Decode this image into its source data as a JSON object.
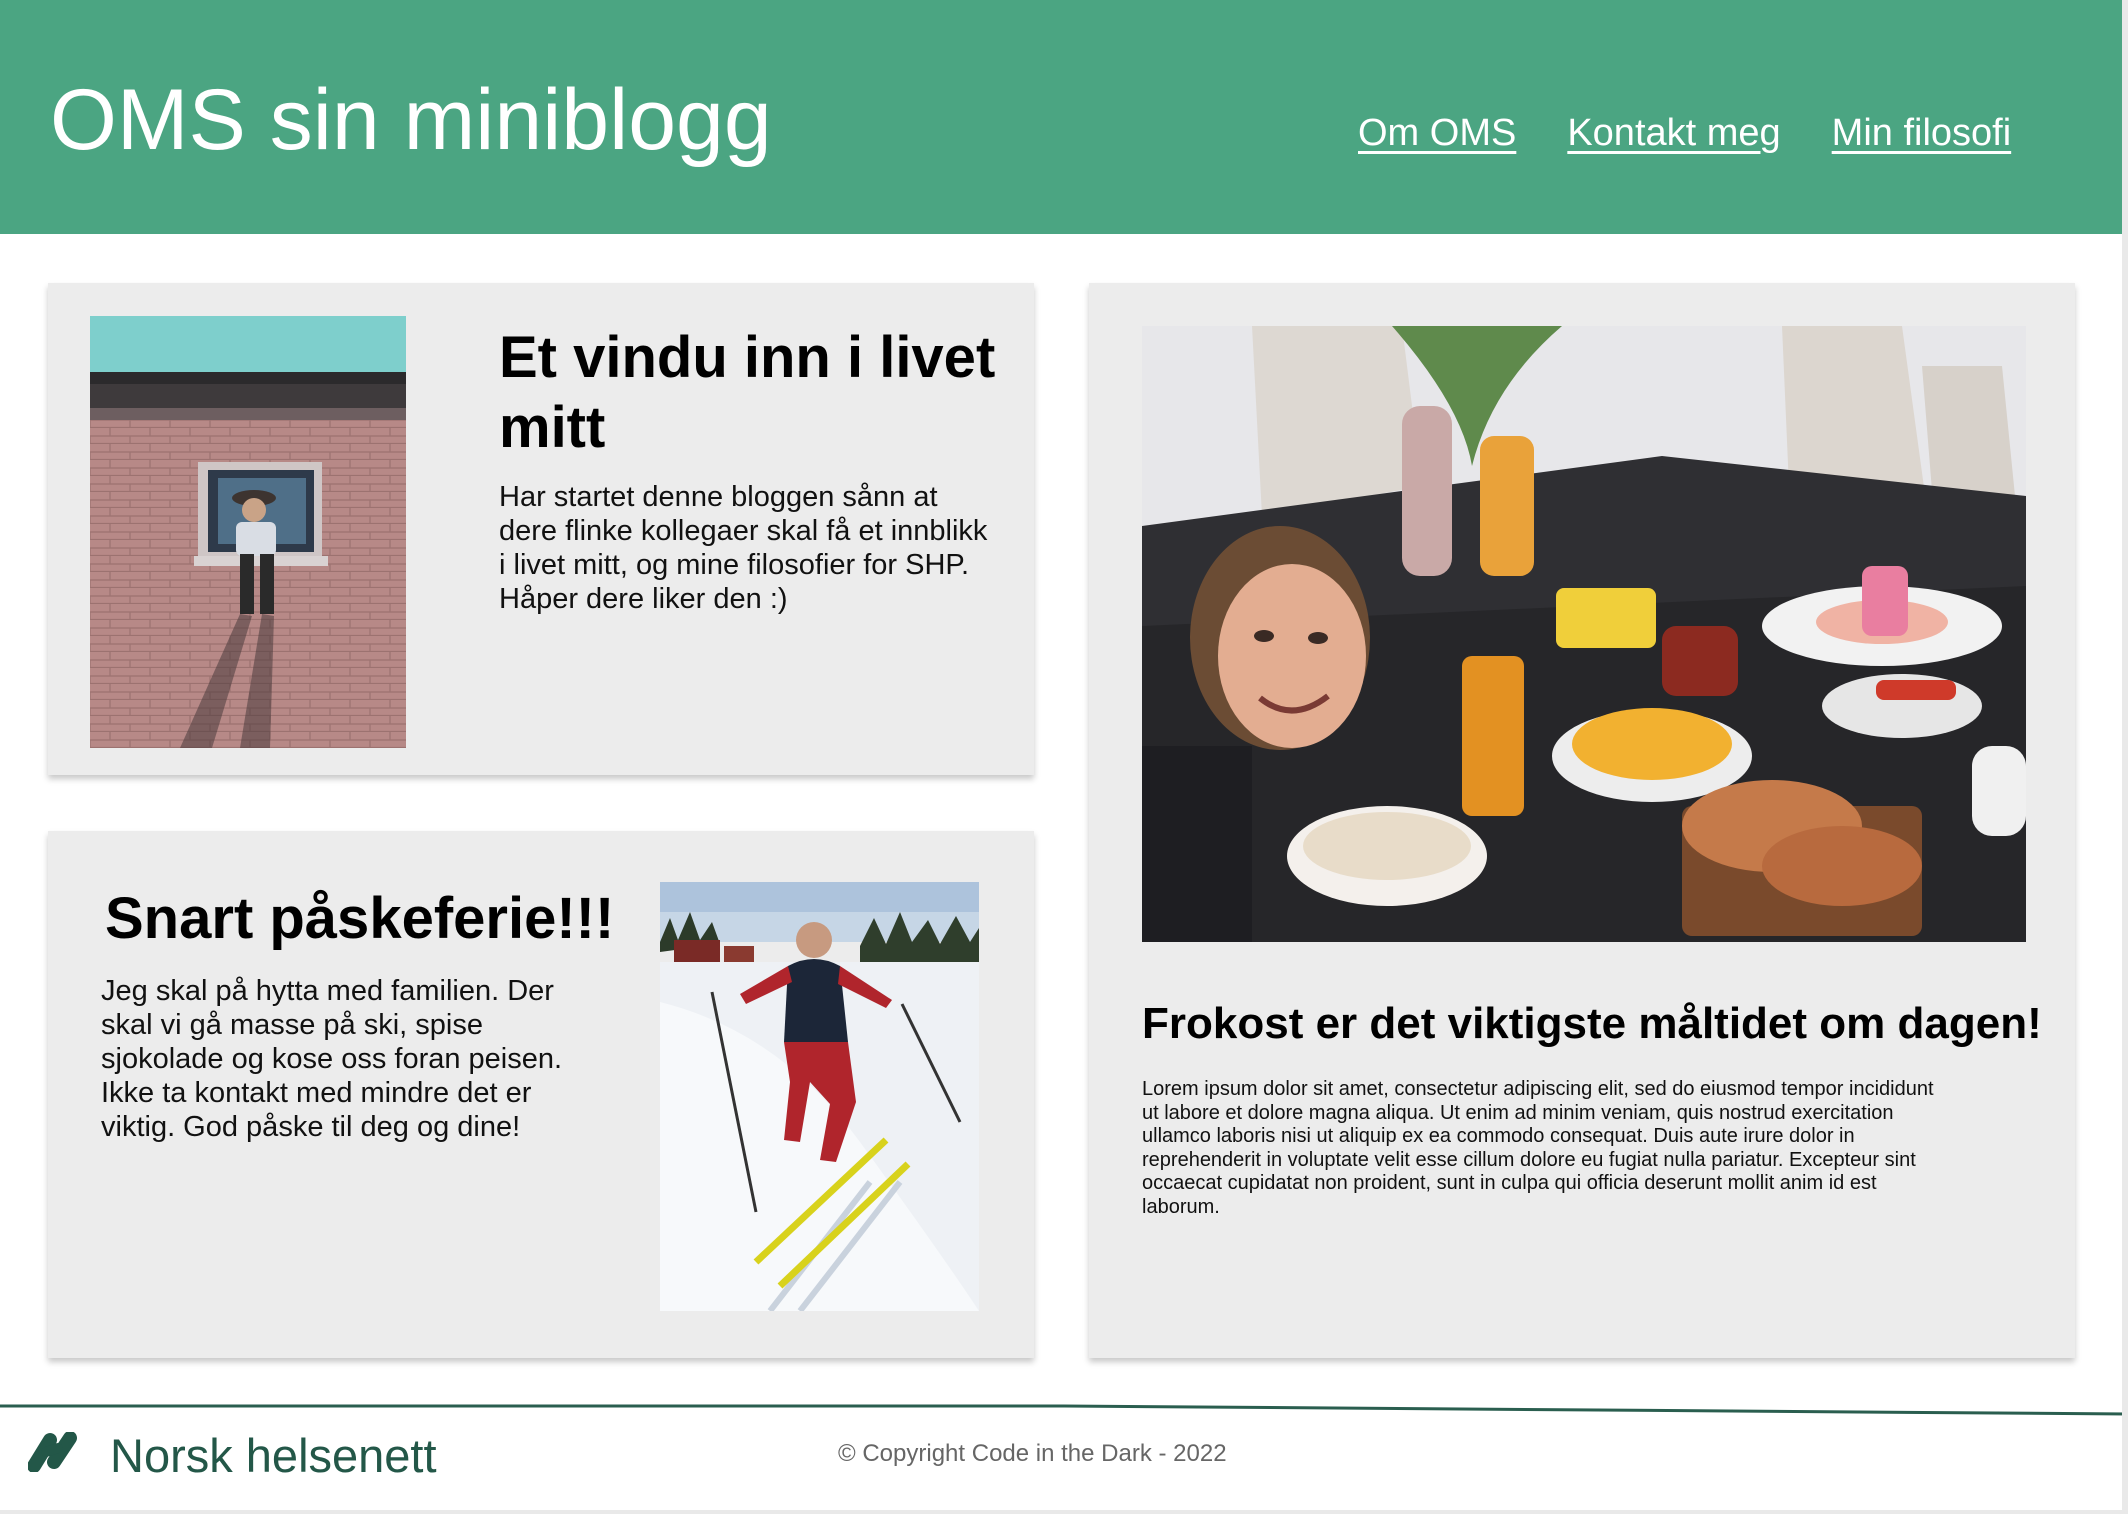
{
  "header": {
    "title": "OMS sin miniblogg",
    "nav": [
      "Om OMS",
      "Kontakt meg",
      "Min filosofi"
    ]
  },
  "posts": [
    {
      "title": "Et vindu inn i livet mitt",
      "text": "Har startet denne bloggen sånn at dere flinke kollegaer skal få et innblikk i livet mitt, og mine filosofier for SHP. Håper dere liker den :)",
      "image": "window-photo"
    },
    {
      "title": "Snart påskeferie!!!",
      "text": "Jeg skal på hytta med familien. Der skal vi gå masse på ski, spise sjokolade og kose oss foran peisen. Ikke ta kontakt med mindre det er viktig. God påske til deg og dine!",
      "image": "skiing-photo"
    },
    {
      "title": "Frokost er det viktigste måltidet om dagen!",
      "text": "Lorem ipsum dolor sit amet, consectetur adipiscing elit, sed do eiusmod tempor incididunt ut labore et dolore magna aliqua. Ut enim ad minim veniam, quis nostrud exercitation ullamco laboris nisi ut aliquip ex ea commodo consequat. Duis aute irure dolor in reprehenderit in voluptate velit esse cillum dolore eu fugiat nulla pariatur. Excepteur sint occaecat cupidatat non proident, sunt in culpa qui officia deserunt mollit anim id est laborum.",
      "image": "breakfast-photo"
    }
  ],
  "footer": {
    "brand": "Norsk helsenett",
    "copyright": "© Copyright Code in the Dark - 2022",
    "logo_icon": "norsk-helsenett-logo"
  },
  "colors": {
    "header_bg": "#4ba582",
    "card_bg": "#ececec",
    "footer_brand": "#235748"
  }
}
